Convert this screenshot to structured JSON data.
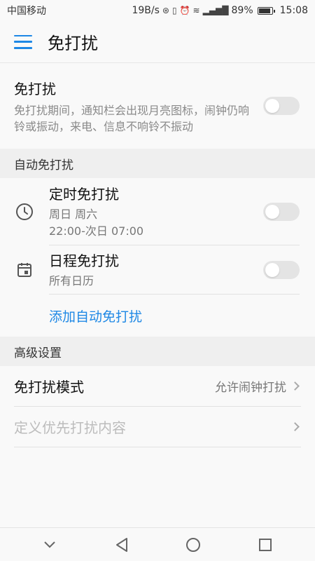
{
  "status_bar": {
    "carrier": "中国移动",
    "speed": "19B/s",
    "battery": "89%",
    "time": "15:08",
    "icons": [
      "data-saver-icon",
      "vibrate-icon",
      "alarm-icon",
      "wifi-icon",
      "signal-4g-icon",
      "battery-icon"
    ]
  },
  "app_bar": {
    "title": "免打扰",
    "menu_icon": "hamburger-menu-icon"
  },
  "dnd": {
    "title": "免打扰",
    "description": "免打扰期间，通知栏会出现月亮图标，闹钟仍响铃或振动，来电、信息不响铃不振动",
    "enabled": false
  },
  "auto_section": {
    "header": "自动免打扰",
    "items": [
      {
        "icon": "clock-icon",
        "title": "定时免打扰",
        "sub1": "周日 周六",
        "sub2": "22:00-次日 07:00",
        "enabled": false
      },
      {
        "icon": "calendar-icon",
        "title": "日程免打扰",
        "sub1": "所有日历",
        "enabled": false
      }
    ],
    "add_label": "添加自动免打扰"
  },
  "advanced_section": {
    "header": "高级设置",
    "mode_label": "免打扰模式",
    "mode_value": "允许闹钟打扰",
    "priority_label": "定义优先打扰内容"
  },
  "nav_bar": {
    "icons": [
      "chevron-down-icon",
      "back-icon",
      "home-icon",
      "recents-icon"
    ]
  },
  "colors": {
    "accent": "#1e88e5",
    "toggle_off": "#e4e4e4",
    "section_bg": "#efefef"
  }
}
